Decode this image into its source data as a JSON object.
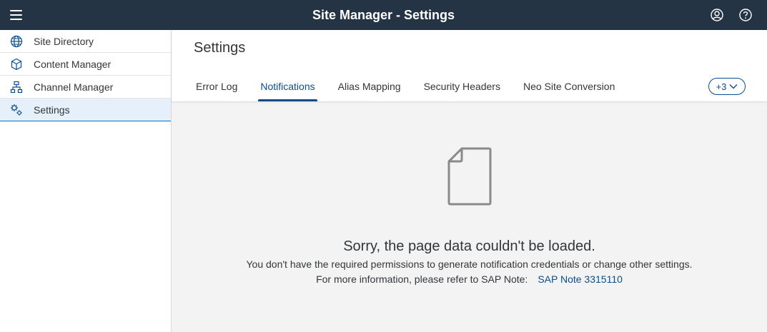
{
  "shell": {
    "title": "Site Manager - Settings",
    "menu_icon": "hamburger-menu-icon",
    "user_icon": "user-profile-icon",
    "help_icon": "help-icon",
    "color": "#253444"
  },
  "sidebar": {
    "items": [
      {
        "label": "Site Directory",
        "icon": "globe-icon",
        "selected": false
      },
      {
        "label": "Content Manager",
        "icon": "cube-icon",
        "selected": false
      },
      {
        "label": "Channel Manager",
        "icon": "hierarchy-icon",
        "selected": false
      },
      {
        "label": "Settings",
        "icon": "gears-icon",
        "selected": true
      }
    ],
    "selected_bg": "#e5f0fa"
  },
  "main": {
    "title": "Settings",
    "tabs": [
      {
        "label": "Error Log",
        "active": false
      },
      {
        "label": "Notifications",
        "active": true
      },
      {
        "label": "Alias Mapping",
        "active": false
      },
      {
        "label": "Security Headers",
        "active": false
      },
      {
        "label": "Neo Site Conversion",
        "active": false
      }
    ],
    "overflow_label": "+3",
    "accent": "#0a4d8c"
  },
  "empty_state": {
    "icon": "document-icon",
    "title": "Sorry, the page data couldn't be loaded.",
    "line1": "You don't have the required permissions to generate notification credentials or change other settings.",
    "line2_prefix": "For more information, please refer to SAP Note:",
    "link_text": "SAP Note 3315110"
  }
}
